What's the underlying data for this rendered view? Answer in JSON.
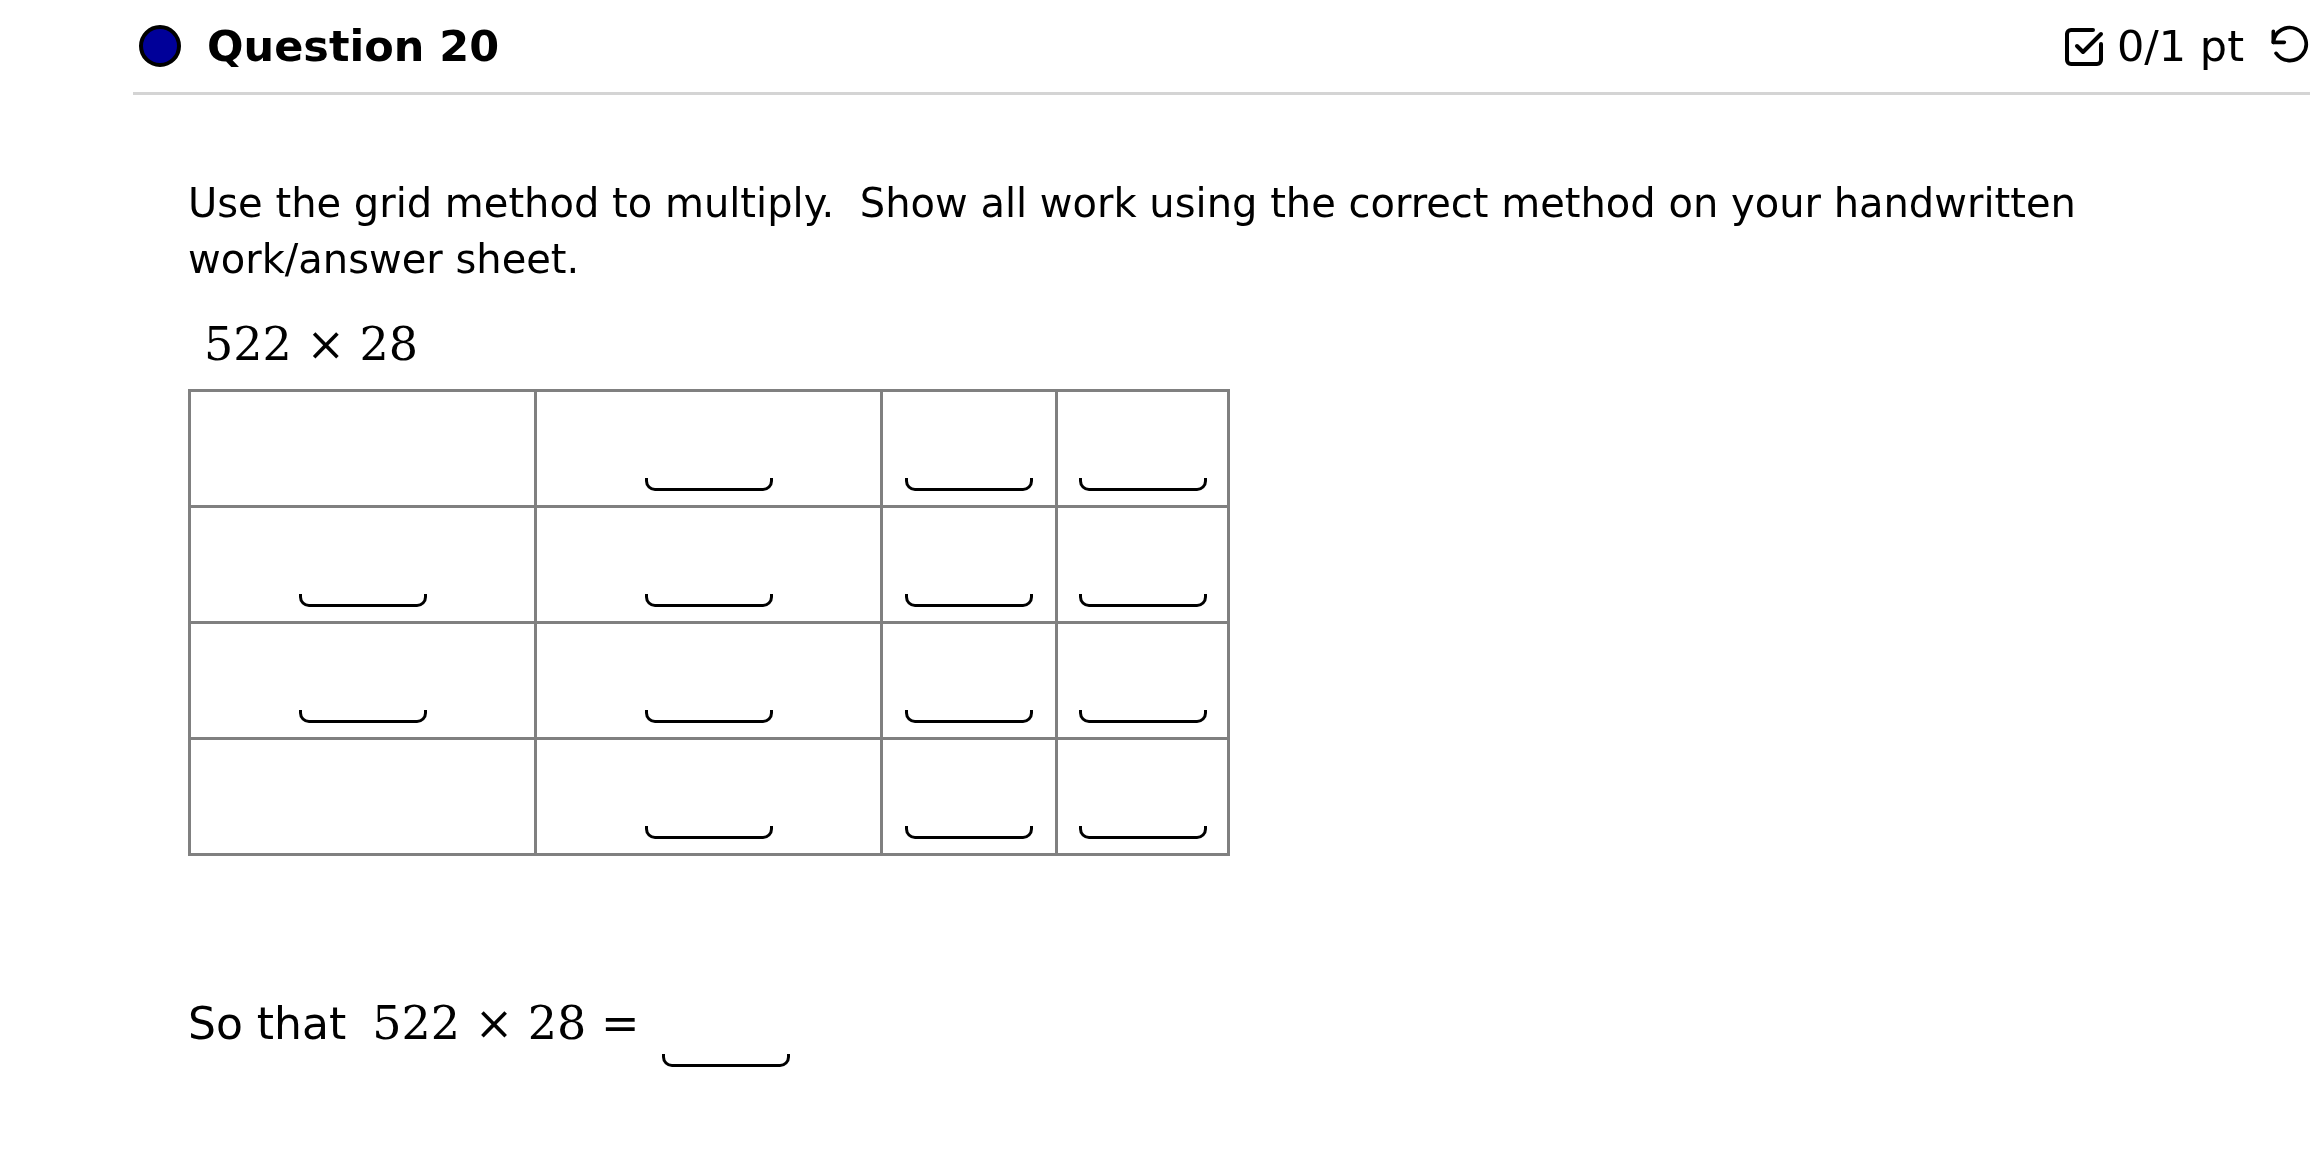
{
  "question": {
    "title": "Question 20",
    "color": "#000099",
    "score": "0/1 pt"
  },
  "prompt": "Use the grid method to multiply.  Show all work using the correct method on your handwritten work/answer sheet.",
  "expression": "522 × 28",
  "grid": {
    "rows": [
      {
        "cells": [
          {
            "kind": "empty"
          },
          {
            "kind": "blank"
          },
          {
            "kind": "blank"
          },
          {
            "kind": "blank"
          }
        ]
      },
      {
        "cells": [
          {
            "kind": "blank"
          },
          {
            "kind": "blank"
          },
          {
            "kind": "blank"
          },
          {
            "kind": "blank"
          }
        ]
      },
      {
        "cells": [
          {
            "kind": "blank"
          },
          {
            "kind": "blank"
          },
          {
            "kind": "blank"
          },
          {
            "kind": "blank"
          }
        ]
      },
      {
        "cells": [
          {
            "kind": "empty"
          },
          {
            "kind": "blank"
          },
          {
            "kind": "blank"
          },
          {
            "kind": "blank"
          }
        ]
      }
    ]
  },
  "conclusion": {
    "lead": "So that",
    "expression": "522 × 28 ="
  }
}
